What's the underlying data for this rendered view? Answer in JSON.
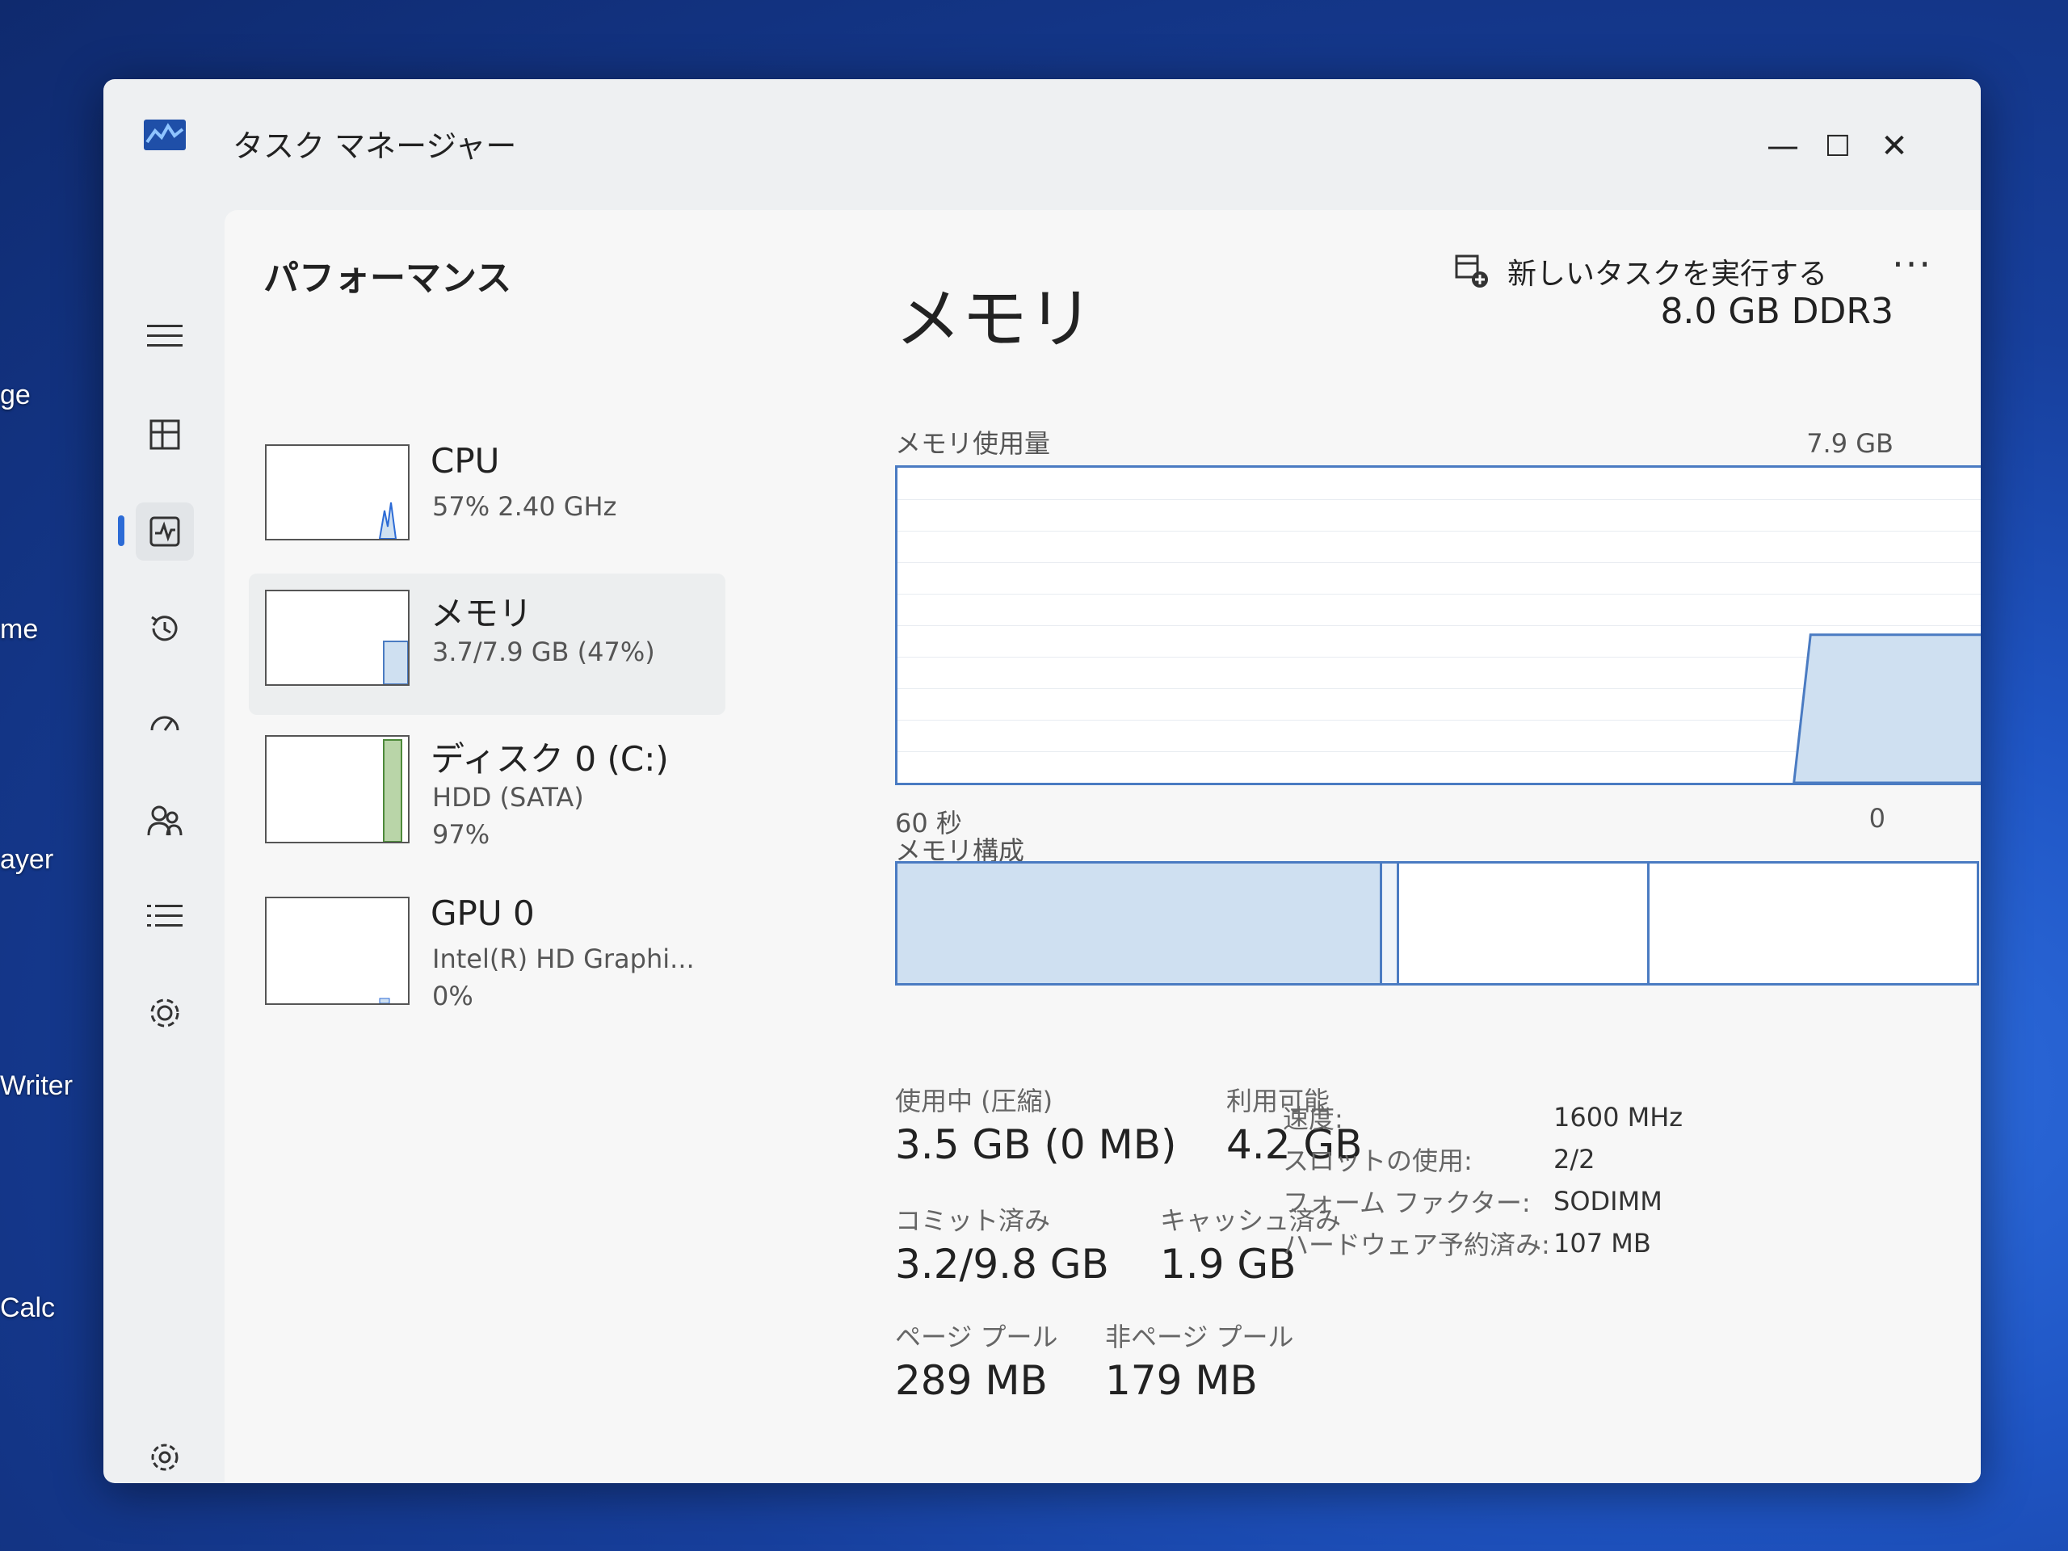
{
  "desktop": {
    "labels": [
      "ge",
      "me",
      "ayer",
      "Writer",
      "Calc"
    ]
  },
  "window": {
    "title": "タスク マネージャー"
  },
  "window_controls": {
    "minimize": "—",
    "maximize": "☐",
    "close": "✕"
  },
  "nav": {
    "items": [
      {
        "icon": "hamburger-icon"
      },
      {
        "icon": "processes-icon"
      },
      {
        "icon": "performance-icon",
        "active": true
      },
      {
        "icon": "app-history-icon"
      },
      {
        "icon": "startup-icon"
      },
      {
        "icon": "users-icon"
      },
      {
        "icon": "details-icon"
      },
      {
        "icon": "services-icon"
      },
      {
        "icon": "settings-icon"
      }
    ]
  },
  "header": {
    "title": "パフォーマンス",
    "run_task": "新しいタスクを実行する",
    "more": "···"
  },
  "resources": [
    {
      "name": "CPU",
      "line1": "57% 2.40 GHz",
      "line2": ""
    },
    {
      "name": "メモリ",
      "line1": "3.7/7.9 GB (47%)",
      "line2": "",
      "selected": true
    },
    {
      "name": "ディスク 0 (C:)",
      "line1": "HDD (SATA)",
      "line2": "97%"
    },
    {
      "name": "GPU 0",
      "line1": "Intel(R) HD Graphi...",
      "line2": "0%"
    }
  ],
  "detail": {
    "title": "メモリ",
    "spec": "8.0 GB DDR3",
    "usage_label": "メモリ使用量",
    "usage_max": "7.9 GB",
    "axis_left": "60 秒",
    "axis_right": "0",
    "composition_label": "メモリ構成",
    "composition_in_use_fraction": 0.447,
    "usage_percent": 47,
    "stats": {
      "in_use_label": "使用中 (圧縮)",
      "in_use_value": "3.5 GB (0 MB)",
      "available_label": "利用可能",
      "available_value": "4.2 GB",
      "committed_label": "コミット済み",
      "committed_value": "3.2/9.8 GB",
      "cached_label": "キャッシュ済み",
      "cached_value": "1.9 GB",
      "paged_label": "ページ プール",
      "paged_value": "289 MB",
      "nonpaged_label": "非ページ プール",
      "nonpaged_value": "179 MB"
    },
    "props": [
      {
        "key": "速度:",
        "value": "1600 MHz"
      },
      {
        "key": "スロットの使用:",
        "value": "2/2"
      },
      {
        "key": "フォーム ファクター:",
        "value": "SODIMM"
      },
      {
        "key": "ハードウェア予約済み:",
        "value": "107 MB"
      }
    ]
  },
  "colors": {
    "accent": "#2c6bd6",
    "memory_fill": "#cfe0f1",
    "memory_stroke": "#4a7bc2",
    "disk_fill": "#b9d5a8",
    "disk_stroke": "#4d8a3a"
  }
}
